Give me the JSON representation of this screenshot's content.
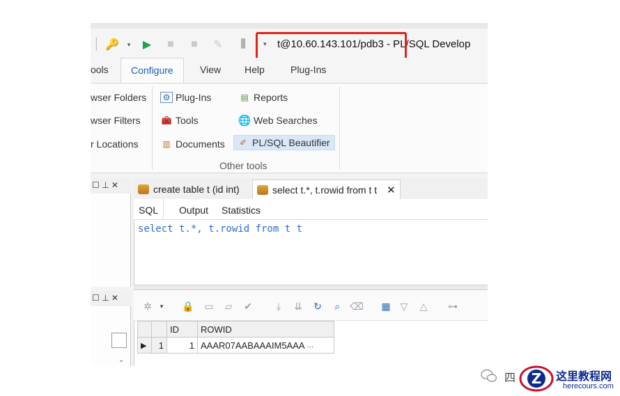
{
  "titlebar": {
    "title": "t@10.60.143.101/pdb3 - PL/SQL Develop",
    "dropdown_glyph": "▾"
  },
  "menu": {
    "tabs": [
      "ools",
      "Configure",
      "View",
      "Help",
      "Plug-Ins"
    ],
    "active": "Configure"
  },
  "ribbon": {
    "left_items": [
      "wser Folders",
      "wser Filters",
      "r Locations"
    ],
    "mid_items": [
      "Plug-Ins",
      "Tools",
      "Documents"
    ],
    "right_items": [
      "Reports",
      "Web Searches",
      "PL/SQL Beautifier"
    ],
    "group_label": "Other tools"
  },
  "dock": {
    "pin_glyphs": "☐ ⊥ ✕"
  },
  "editor": {
    "tabs": [
      "create table t (id int)",
      "select t.*, t.rowid from t t"
    ],
    "close_glyph": "✕",
    "sub_tabs": [
      "SQL",
      "Output",
      "Statistics"
    ],
    "sql_text": "select t.*, t.rowid from t t"
  },
  "grid": {
    "columns": [
      "ID",
      "ROWID"
    ],
    "rows": [
      {
        "row_num": "1",
        "id": "1",
        "rowid": "AAAR07AABAAAIM5AAA",
        "more": "···"
      }
    ]
  },
  "watermark": {
    "text": "四",
    "site_cn": "这里教程网",
    "site_url": "herecours.com"
  }
}
